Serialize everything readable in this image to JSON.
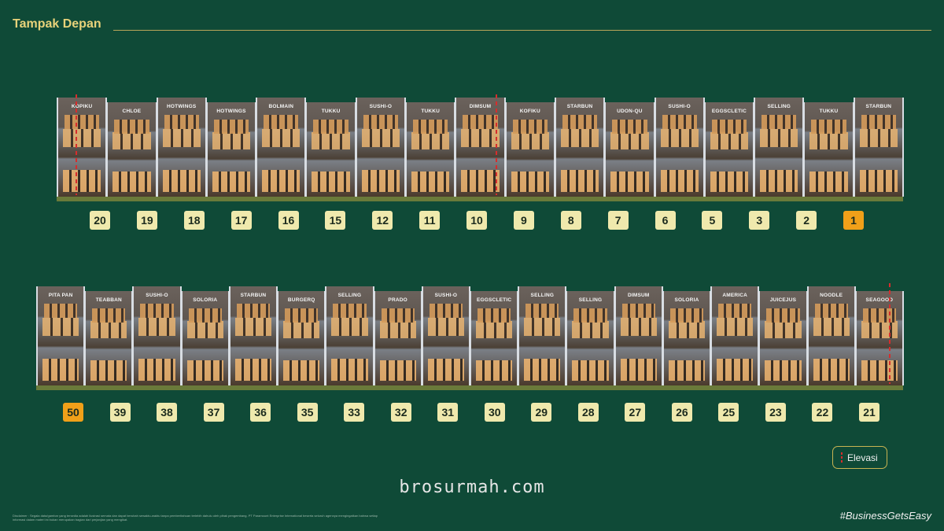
{
  "header": {
    "title": "Tampak Depan"
  },
  "top_row": {
    "stores": [
      "KOPIKU",
      "CHLOE",
      "HOTWINGS",
      "HOTWINGS",
      "BOLMAIN",
      "TUKKU",
      "SUSHI-O",
      "TUKKU",
      "DIMSUM",
      "KOFIKU",
      "STARBUN",
      "UDON-QU",
      "SUSHI-O",
      "EGGSCLETIC",
      "SELLING",
      "TUKKU",
      "STARBUN"
    ],
    "units": [
      "20",
      "19",
      "18",
      "17",
      "16",
      "15",
      "12",
      "11",
      "10",
      "9",
      "8",
      "7",
      "6",
      "5",
      "3",
      "2",
      "1"
    ]
  },
  "bottom_row": {
    "stores": [
      "PITA PAN",
      "TEABBAN",
      "SUSHI-O",
      "SOLORIA",
      "STARBUN",
      "BURGERQ",
      "SELLING",
      "PRADO",
      "SUSHI-O",
      "EGGSCLETIC",
      "SELLING",
      "SELLING",
      "DIMSUM",
      "SOLORIA",
      "AMERICA",
      "JUICEJUS",
      "NOODLE",
      "SEAGOOD"
    ],
    "units": [
      "50",
      "39",
      "38",
      "37",
      "36",
      "35",
      "33",
      "32",
      "31",
      "30",
      "29",
      "28",
      "27",
      "26",
      "25",
      "23",
      "22",
      "21"
    ]
  },
  "highlighted_units": [
    "1",
    "50"
  ],
  "legend": {
    "label": "Elevasi",
    "marker_color": "#d62d2d"
  },
  "watermark": "brosurmah.com",
  "hashtag": "#BusinessGetsEasy",
  "disclaimer": "Disclaimer : Segala data/gambar yang tersedia adalah ilustrasi semata dan dapat berubah sewaktu-waktu tanpa pemberitahuan terlebih dahulu oleh pihak pengembang. PT Paramount Enterprise International beserta seluruh agennya mengingatkan bahwa setiap informasi dalam materi ini bukan merupakan bagian dari perjanjian yang mengikat.",
  "colors": {
    "background": "#0f4a37",
    "title": "#e8d27a",
    "unit_badge": "#efe9ad",
    "unit_highlight": "#f0a019"
  }
}
